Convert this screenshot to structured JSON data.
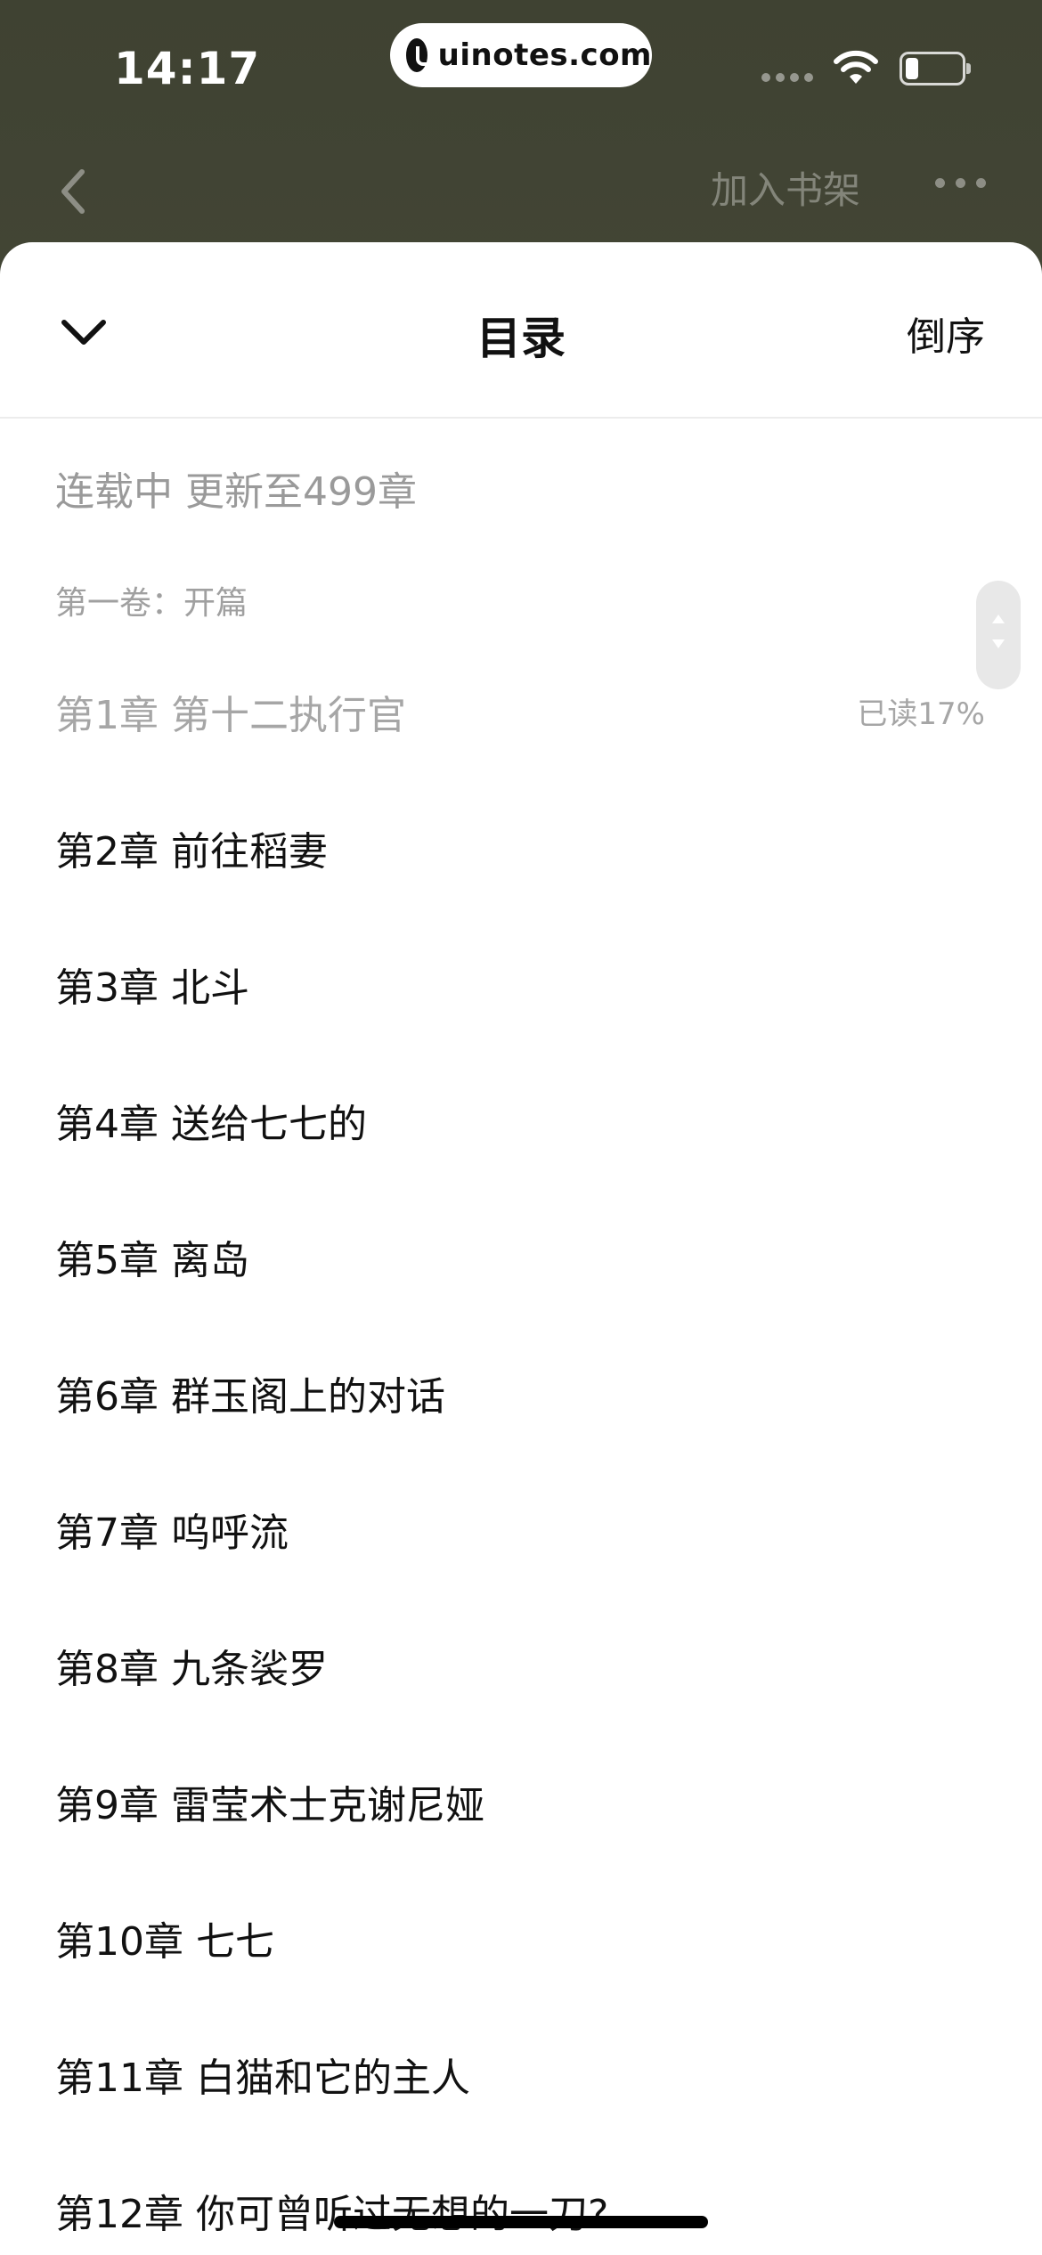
{
  "status_bar": {
    "time": "14:17",
    "url": "uinotes.com"
  },
  "nav": {
    "add_to_shelf": "加入书架"
  },
  "sheet": {
    "title": "目录",
    "order_button": "倒序",
    "meta": "连载中 更新至499章",
    "volume": "第一卷：开篇"
  },
  "chapters": [
    {
      "title": "第1章 第十二执行官",
      "progress": "已读17%"
    },
    {
      "title": "第2章 前往稻妻"
    },
    {
      "title": "第3章 北斗"
    },
    {
      "title": "第4章 送给七七的"
    },
    {
      "title": "第5章 离岛"
    },
    {
      "title": "第6章 群玉阁上的对话"
    },
    {
      "title": "第7章 呜呼流"
    },
    {
      "title": "第8章 九条裟罗"
    },
    {
      "title": "第9章 雷莹术士克谢尼娅"
    },
    {
      "title": "第10章 七七"
    },
    {
      "title": "第11章 白猫和它的主人"
    },
    {
      "title": "第12章 你可曾听过无想的一刀?"
    }
  ]
}
